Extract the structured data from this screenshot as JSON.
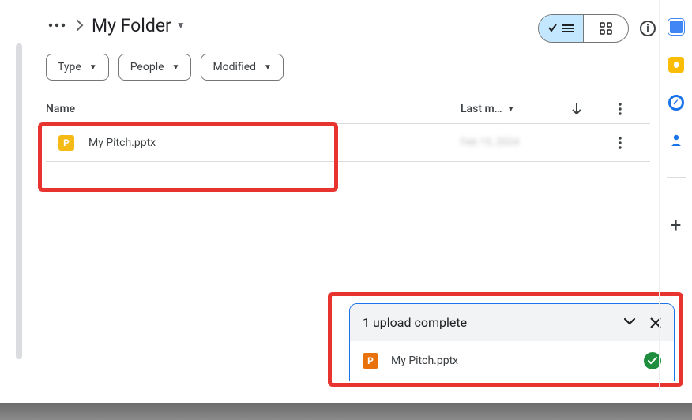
{
  "breadcrumb": {
    "folder_title": "My Folder"
  },
  "filters": {
    "type": "Type",
    "people": "People",
    "modified": "Modified"
  },
  "columns": {
    "name": "Name",
    "last_modified": "Last m…"
  },
  "files": [
    {
      "name": "My Pitch.pptx",
      "icon_letter": "P",
      "modified": "Feb 15, 2024"
    }
  ],
  "upload": {
    "title": "1 upload complete",
    "items": [
      {
        "name": "My Pitch.pptx",
        "icon_letter": "P",
        "status": "complete"
      }
    ]
  }
}
